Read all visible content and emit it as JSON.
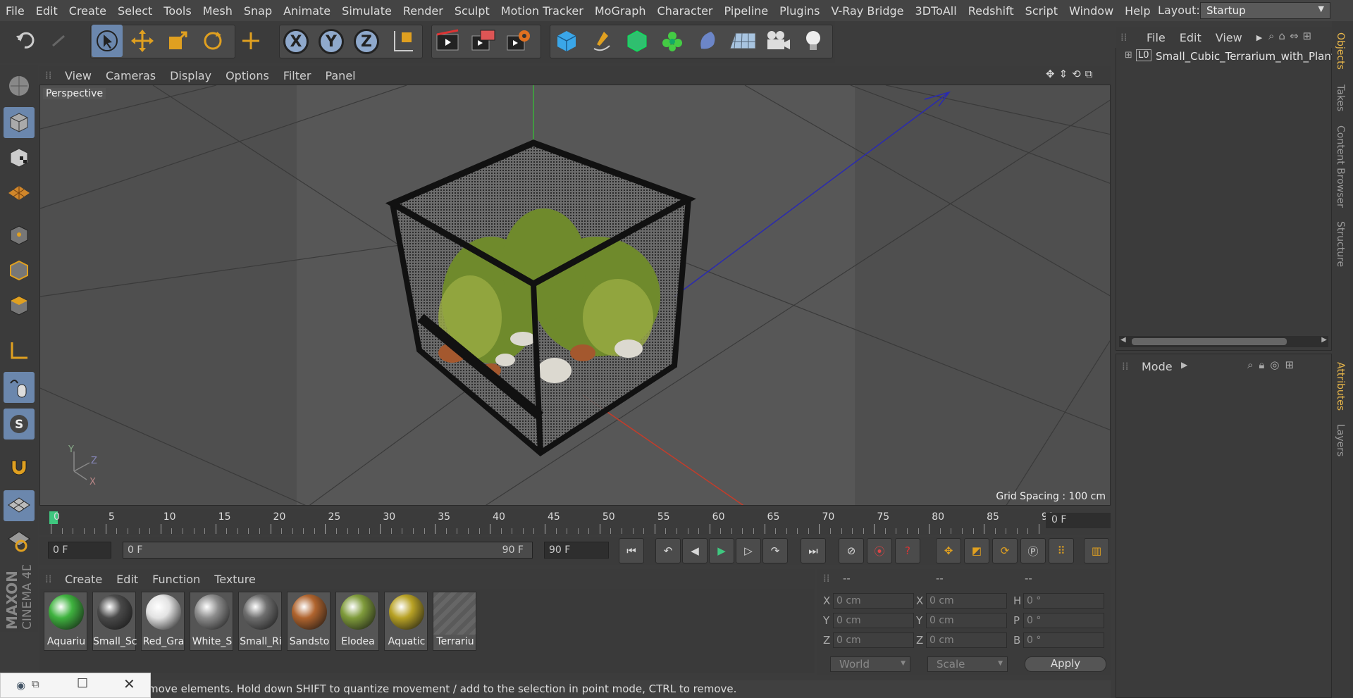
{
  "menubar": {
    "items": [
      "File",
      "Edit",
      "Create",
      "Select",
      "Tools",
      "Mesh",
      "Snap",
      "Animate",
      "Simulate",
      "Render",
      "Sculpt",
      "Motion Tracker",
      "MoGraph",
      "Character",
      "Pipeline",
      "Plugins",
      "V-Ray Bridge",
      "3DToAll",
      "Redshift",
      "Script",
      "Window",
      "Help"
    ],
    "layout_label": "Layout:",
    "layout_value": "Startup"
  },
  "toolbar": {
    "axis_x": "X",
    "axis_y": "Y",
    "axis_z": "Z"
  },
  "viewport": {
    "menu": [
      "View",
      "Cameras",
      "Display",
      "Options",
      "Filter",
      "Panel"
    ],
    "camera_label": "Perspective",
    "grid_spacing": "Grid Spacing : 100 cm",
    "axis_labels": [
      "Y",
      "Z",
      "X"
    ]
  },
  "timeline": {
    "ticks": [
      "0",
      "5",
      "10",
      "15",
      "20",
      "25",
      "30",
      "35",
      "40",
      "45",
      "50",
      "55",
      "60",
      "65",
      "70",
      "75",
      "80",
      "85",
      "90"
    ],
    "current_frame": "0 F"
  },
  "transport": {
    "start_field": "0 F",
    "range_start": "0 F",
    "range_end": "90 F",
    "end_field": "90 F"
  },
  "materials": {
    "menu": [
      "Create",
      "Edit",
      "Function",
      "Texture"
    ],
    "items": [
      {
        "label": "Aquariu",
        "color": "#3fb33f"
      },
      {
        "label": "Small_Sc",
        "color": "#4a4a4a"
      },
      {
        "label": "Red_Gra",
        "color": "#e3e3e3"
      },
      {
        "label": "White_S",
        "color": "#8d8d8d"
      },
      {
        "label": "Small_Ri",
        "color": "#6f6f6f"
      },
      {
        "label": "Sandsto",
        "color": "#b0642e"
      },
      {
        "label": "Elodea",
        "color": "#7f9b3b"
      },
      {
        "label": "Aquatic",
        "color": "#b8a225"
      },
      {
        "label": "Terrariu",
        "color": "#5a5a5a"
      }
    ]
  },
  "coordinates": {
    "headers": [
      "--",
      "--",
      "--"
    ],
    "rows": [
      [
        "X",
        "0 cm",
        "X",
        "0 cm",
        "H",
        "0 °"
      ],
      [
        "Y",
        "0 cm",
        "Y",
        "0 cm",
        "P",
        "0 °"
      ],
      [
        "Z",
        "0 cm",
        "Z",
        "0 cm",
        "B",
        "0 °"
      ]
    ],
    "world": "World",
    "scale": "Scale",
    "apply": "Apply"
  },
  "status": {
    "text": "move elements. Hold down SHIFT to quantize movement / add to the selection in point mode, CTRL to remove."
  },
  "objects": {
    "menu": [
      "File",
      "Edit",
      "View"
    ],
    "object_name": "Small_Cubic_Terrarium_with_Plants"
  },
  "attributes": {
    "mode": "Mode"
  },
  "side_tabs": [
    "Objects",
    "Takes",
    "Content Browser",
    "Structure",
    "Attributes",
    "Layers"
  ],
  "colors": {
    "accent": "#6b87ad",
    "active_tab": "#e8b64a"
  }
}
